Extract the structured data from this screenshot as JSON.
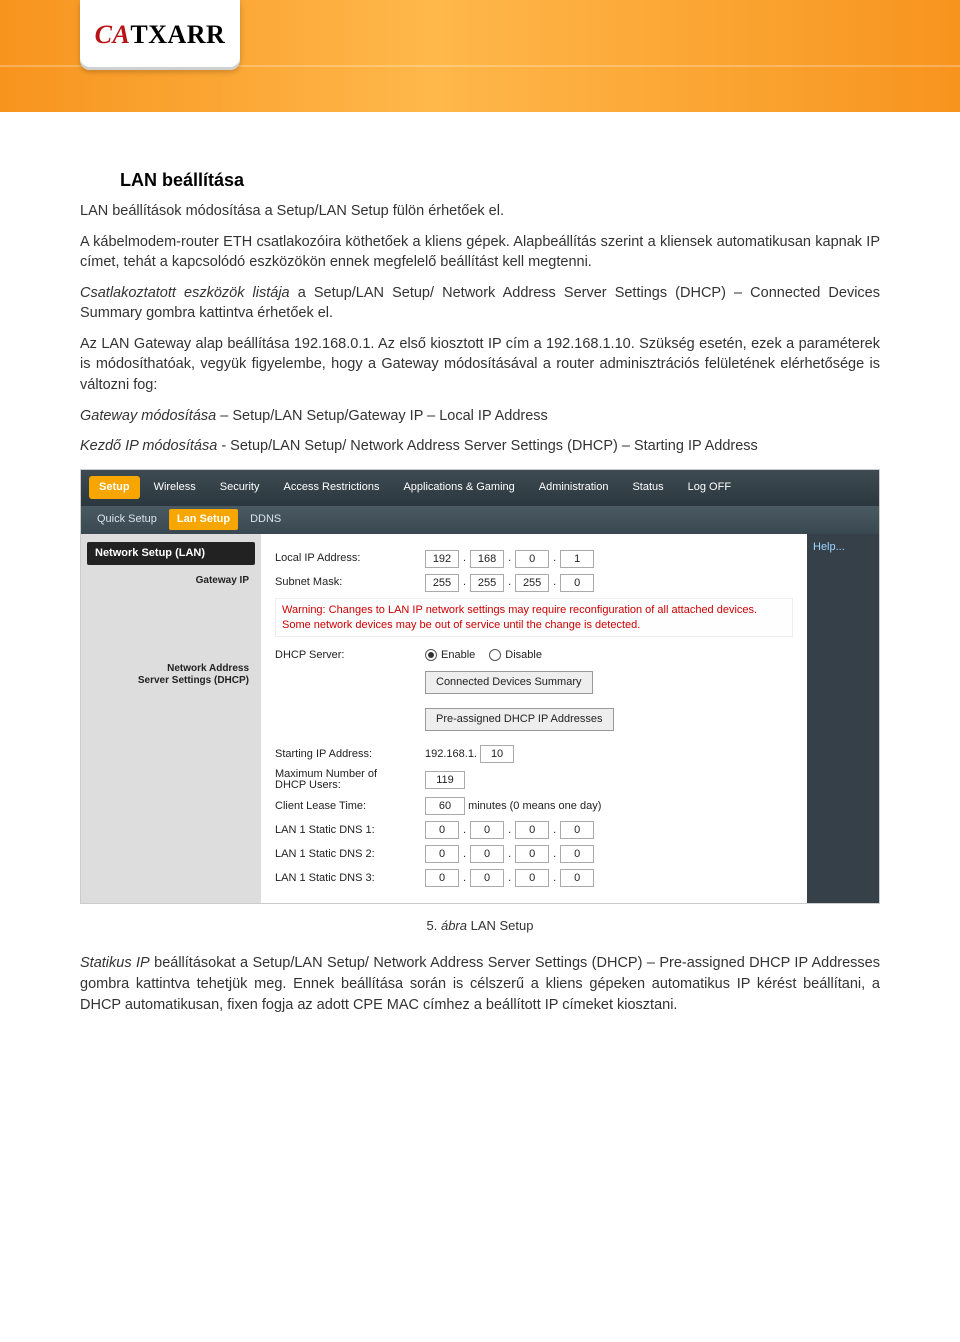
{
  "section_title": "LAN beállítása",
  "p1": "LAN beállítások módosítása a Setup/LAN Setup fülön érhetőek el.",
  "p2": "A kábelmodem-router ETH csatlakozóira köthetőek a kliens gépek. Alapbeállítás szerint a kliensek automatikusan kapnak IP címet, tehát a kapcsolódó eszközökön ennek megfelelő beállítást kell megtenni.",
  "p3a": "Csatlakoztatott eszközök listája",
  "p3b": " a Setup/LAN Setup/ Network Address Server Settings (DHCP) – Connected Devices Summary gombra kattintva érhetőek el.",
  "p4": "Az LAN Gateway alap beállítása 192.168.0.1. Az első kiosztott IP cím a 192.168.1.10. Szükség esetén, ezek a paraméterek is módosíthatóak, vegyük figyelembe, hogy a Gateway módosításával a router adminisztrációs felületének elérhetősége is változni fog:",
  "p5a": "Gateway módosítása",
  "p5b": " – Setup/LAN Setup/Gateway IP – Local IP Address",
  "p6a": "Kezdő IP módosítása",
  "p6b": " - Setup/LAN Setup/ Network Address Server Settings (DHCP) – Starting IP Address",
  "caption_num": "5.",
  "caption_lbl": " ábra ",
  "caption_txt": "LAN Setup",
  "p7a": "Statikus IP",
  "p7b": " beállításokat a Setup/LAN Setup/ Network Address Server Settings (DHCP) – Pre-assigned DHCP IP Addresses gombra kattintva tehetjük meg. Ennek beállítása során is célszerű a kliens gépeken automatikus IP kérést beállítani, a DHCP automatikusan, fixen fogja az adott CPE MAC címhez a beállított IP címeket kiosztani.",
  "router": {
    "tabs": [
      "Setup",
      "Wireless",
      "Security",
      "Access Restrictions",
      "Applications & Gaming",
      "Administration",
      "Status",
      "Log OFF"
    ],
    "subtabs": [
      "Quick Setup",
      "Lan Setup",
      "DDNS"
    ],
    "sidebar": {
      "block_title": "Network Setup (LAN)",
      "gateway_label": "Gateway IP",
      "nas_label1": "Network Address",
      "nas_label2": "Server Settings (DHCP)"
    },
    "fields": {
      "local_ip_label": "Local IP Address:",
      "local_ip": [
        "192",
        "168",
        "0",
        "1"
      ],
      "subnet_label": "Subnet Mask:",
      "subnet": [
        "255",
        "255",
        "255",
        "0"
      ],
      "warning": "Warning: Changes to LAN IP network settings may require reconfiguration of all attached devices. Some network devices may be out of service until the change is detected.",
      "dhcp_label": "DHCP Server:",
      "enable": "Enable",
      "disable": "Disable",
      "btn_connected": "Connected Devices Summary",
      "btn_preassigned": "Pre-assigned DHCP IP Addresses",
      "starting_label": "Starting IP Address:",
      "starting_prefix": "192.168.1.",
      "starting_val": "10",
      "max_label1": "Maximum Number of",
      "max_label2": "DHCP Users:",
      "max_val": "119",
      "lease_label": "Client Lease Time:",
      "lease_val": "60",
      "lease_unit": "minutes (0 means one day)",
      "dns1_label": "LAN 1 Static DNS 1:",
      "dns2_label": "LAN 1 Static DNS 2:",
      "dns3_label": "LAN 1 Static DNS 3:",
      "dns_val": [
        "0",
        "0",
        "0",
        "0"
      ]
    },
    "help": "Help..."
  }
}
